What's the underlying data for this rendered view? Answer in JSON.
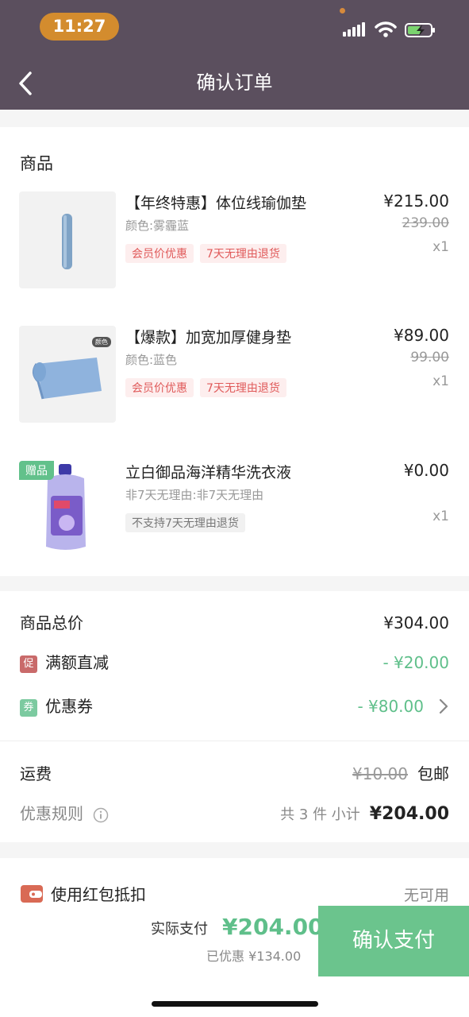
{
  "status": {
    "time": "11:27"
  },
  "header": {
    "title": "确认订单"
  },
  "goods_section": {
    "title": "商品"
  },
  "products": [
    {
      "name": "【年终特惠】体位线瑜伽垫",
      "spec": "颜色:雾霾蓝",
      "tags": [
        "会员价优惠",
        "7天无理由退货"
      ],
      "price": "¥215.00",
      "original_price": "239.00",
      "qty": "x1"
    },
    {
      "name": "【爆款】加宽加厚健身垫",
      "spec": "颜色:蓝色",
      "tags": [
        "会员价优惠",
        "7天无理由退货"
      ],
      "price": "¥89.00",
      "original_price": "99.00",
      "qty": "x1",
      "thumb_badge": "颜色"
    },
    {
      "name": "立白御品海洋精华洗衣液",
      "spec": "非7天无理由:非7天无理由",
      "tags": [
        "不支持7天无理由退货"
      ],
      "price": "¥0.00",
      "qty": "x1",
      "gift_label": "赠品"
    }
  ],
  "summary": {
    "total_label": "商品总价",
    "total_value": "¥304.00",
    "promo_icon": "促",
    "promo_label": "满额直减",
    "promo_value": "- ¥20.00",
    "coupon_icon": "券",
    "coupon_label": "优惠券",
    "coupon_value": "- ¥80.00",
    "shipping_label": "运费",
    "shipping_orig": "¥10.00",
    "shipping_value": "包邮",
    "rules_label": "优惠规则",
    "count_text": "共 3 件 小计",
    "subtotal": "¥204.00"
  },
  "redpacket": {
    "label": "使用红包抵扣",
    "value": "无可用"
  },
  "footer": {
    "pay_label": "实际支付",
    "pay_amount": "¥204.00",
    "saved_text": "已优惠 ¥134.00",
    "confirm_label": "确认支付"
  },
  "colors": {
    "header_bg": "#5b4f5e",
    "accent_green": "#6bc48d",
    "tag_red": "#e05a5a",
    "time_pill": "#d38c2e"
  }
}
